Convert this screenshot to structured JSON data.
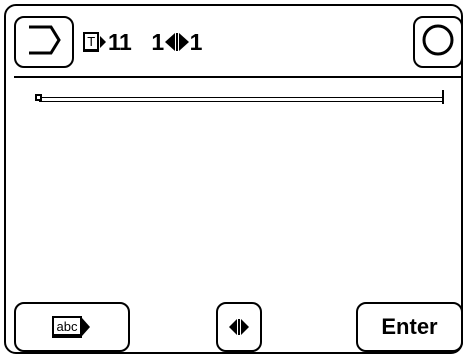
{
  "status": {
    "font_tag": "T",
    "font_size": "11",
    "spacing_left": "1",
    "spacing_right": "1"
  },
  "buttons": {
    "keyboard_mode_label": "abc",
    "enter_label": "Enter"
  },
  "icons": {
    "back": "back-bracket-icon",
    "circle": "circle-icon",
    "spacing": "spacing-arrows-icon",
    "keyboard": "abc-keyboard-icon"
  },
  "colors": {
    "foreground": "#000000",
    "background": "#ffffff"
  }
}
